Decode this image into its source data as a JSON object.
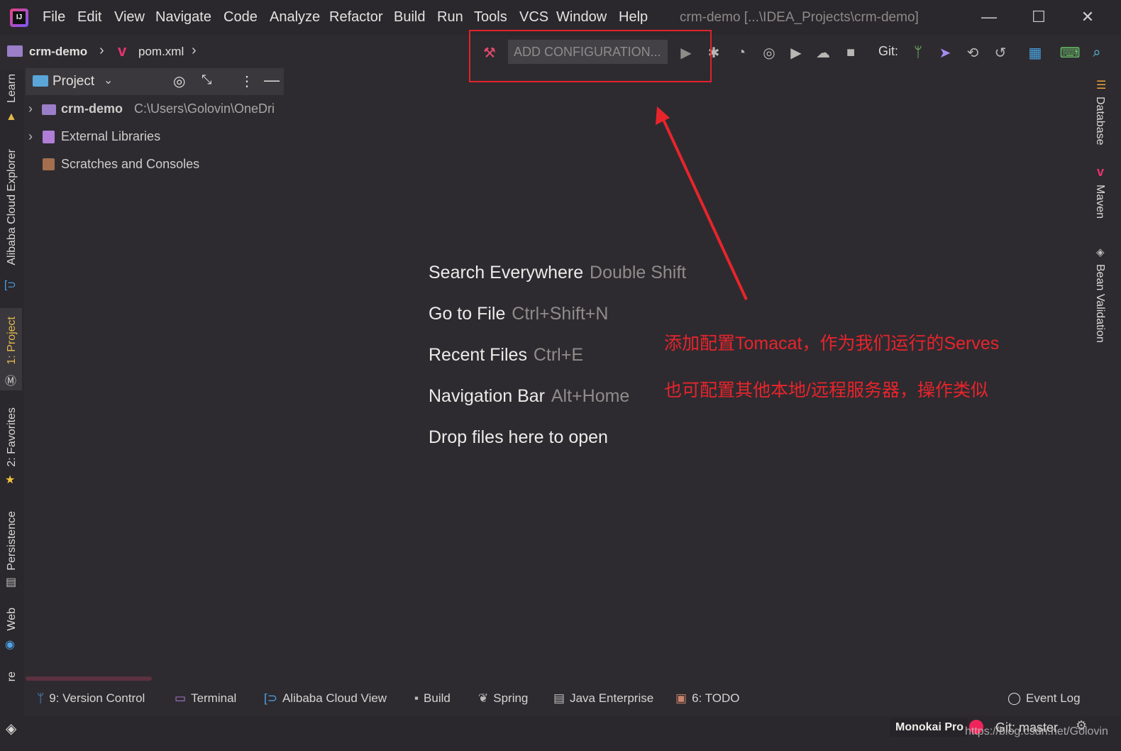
{
  "window": {
    "title": "crm-demo [...\\IDEA_Projects\\crm-demo]",
    "app_icon": "IJ",
    "controls": {
      "minimize": "—",
      "maximize": "☐",
      "close": "✕"
    }
  },
  "menu": [
    "File",
    "Edit",
    "View",
    "Navigate",
    "Code",
    "Analyze",
    "Refactor",
    "Build",
    "Run",
    "Tools",
    "VCS",
    "Window",
    "Help"
  ],
  "breadcrumb": {
    "project": "crm-demo",
    "file": "pom.xml"
  },
  "toolbar": {
    "config_label": "ADD CONFIGURATION...",
    "git_label": "Git:",
    "icons": [
      "hammer-icon",
      "run-icon",
      "debug-icon",
      "coverage-icon",
      "profile-icon",
      "run-ant-icon",
      "gradle-icon",
      "stop-icon",
      "git-branch-icon",
      "git-push-icon",
      "history-icon",
      "rollback-icon",
      "layout-icon",
      "terminal-icon",
      "search-icon"
    ]
  },
  "left_tabs": [
    "Learn",
    "Alibaba Cloud Explorer",
    "1: Project",
    "2: Favorites",
    "Persistence",
    "Web",
    "re"
  ],
  "right_tabs": [
    "Database",
    "Maven",
    "Bean Validation"
  ],
  "project_panel": {
    "title": "Project",
    "tree": [
      {
        "name": "crm-demo",
        "path": "C:\\Users\\Golovin\\OneDri"
      },
      {
        "name": "External Libraries"
      },
      {
        "name": "Scratches and Consoles"
      }
    ]
  },
  "welcome": [
    {
      "label": "Search Everywhere",
      "key": "Double Shift"
    },
    {
      "label": "Go to File",
      "key": "Ctrl+Shift+N"
    },
    {
      "label": "Recent Files",
      "key": "Ctrl+E"
    },
    {
      "label": "Navigation Bar",
      "key": "Alt+Home"
    },
    {
      "label": "Drop files here to open",
      "key": ""
    }
  ],
  "annotation": {
    "line1": "添加配置Tomacat，作为我们运行的Serves",
    "line2": "也可配置其他本地/远程服务器，操作类似",
    "color": "#e8242b"
  },
  "bottom_tabs": [
    "9: Version Control",
    "Terminal",
    "Alibaba Cloud View",
    "Build",
    "Spring",
    "Java Enterprise",
    "6: TODO"
  ],
  "event_log": "Event Log",
  "status": {
    "theme": "Monokai Pro",
    "git": "Git: master",
    "watermark": "https://blog.csdn.net/Golovin"
  }
}
